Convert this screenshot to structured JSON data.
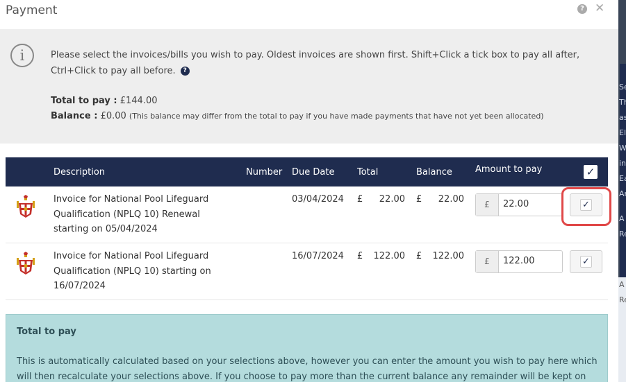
{
  "background": {
    "side_text": [
      "Se",
      "Th",
      "as",
      "El",
      "W",
      "in",
      "Ea",
      "An",
      "A",
      "Re",
      "A",
      "Re"
    ]
  },
  "modal": {
    "title": "Payment"
  },
  "info": {
    "message": "Please select the invoices/bills you wish to pay. Oldest invoices are shown first. Shift+Click a tick box to pay all after, Ctrl+Click to pay all before.",
    "total_label": "Total to pay :",
    "total_value": "£144.00",
    "balance_label": "Balance :",
    "balance_value": "£0.00",
    "balance_note": "(This balance may differ from the total to pay if you have made payments that have not yet been allocated)"
  },
  "table": {
    "headers": {
      "description": "Description",
      "number": "Number",
      "due_date": "Due Date",
      "total": "Total",
      "balance": "Balance",
      "amount": "Amount to pay"
    },
    "currency_symbol": "£",
    "rows": [
      {
        "description": "Invoice for National Pool Lifeguard Qualification (NPLQ 10) Renewal starting on 05/04/2024",
        "number": "",
        "due_date": "03/04/2024",
        "total": "22.00",
        "balance": "22.00",
        "amount": "22.00",
        "checked": true
      },
      {
        "description": "Invoice for National Pool Lifeguard Qualification (NPLQ 10) starting on 16/07/2024",
        "number": "",
        "due_date": "16/07/2024",
        "total": "122.00",
        "balance": "122.00",
        "amount": "122.00",
        "checked": true
      }
    ]
  },
  "total_box": {
    "title": "Total to pay",
    "text": "This is automatically calculated based on your selections above, however you can enter the amount you wish to pay here which will then recalculate your selections above. If you choose to pay more than the current balance any remainder will be kept on account and"
  },
  "colors": {
    "navy": "#1f2c4f",
    "highlight": "#e04848",
    "info_bg": "#eeeeee",
    "total_box_bg": "#b4dcdd"
  },
  "icons": [
    "help-icon",
    "close-icon",
    "info-icon",
    "question-icon",
    "check-icon",
    "crest-icon"
  ]
}
